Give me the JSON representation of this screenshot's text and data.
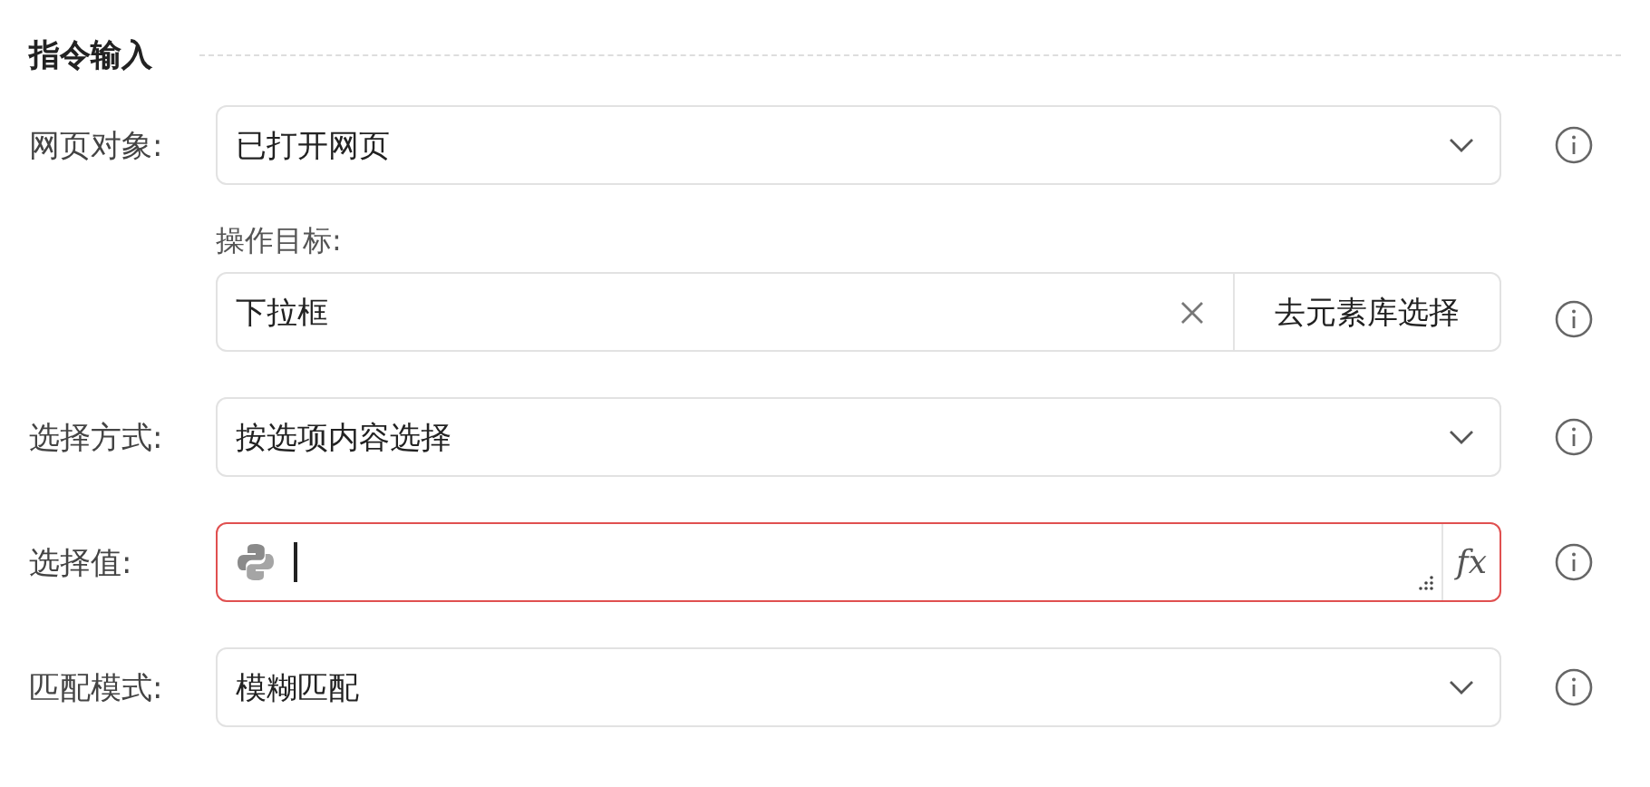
{
  "section": {
    "title": "指令输入"
  },
  "rows": [
    {
      "kind": "select",
      "label": "网页对象:",
      "value": "已打开网页"
    },
    {
      "kind": "target",
      "label": "操作目标:",
      "value": "下拉框",
      "button": "去元素库选择"
    },
    {
      "kind": "select",
      "label": "选择方式:",
      "value": "按选项内容选择"
    },
    {
      "kind": "code",
      "label": "选择值:",
      "error": true,
      "focused": true,
      "fx": "fx"
    },
    {
      "kind": "select",
      "label": "匹配模式:",
      "value": "模糊匹配"
    }
  ]
}
